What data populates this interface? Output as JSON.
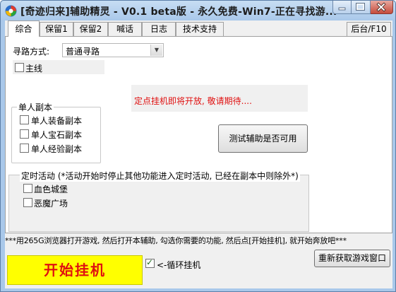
{
  "window": {
    "title": "[奇迹归来]辅助精灵 - V0.1 beta版 - 永久免费-Win7-正在寻找游..."
  },
  "tabs": [
    "综合",
    "保留1",
    "保留2",
    "喊话",
    "日志",
    "技术支持"
  ],
  "tab_right": "后台/F10",
  "path_mode": {
    "label": "寻路方式:",
    "value": "普通寻路"
  },
  "main_line": {
    "label": "主线",
    "checked": false
  },
  "notice": "定点挂机即将开放, 敬请期待....",
  "single_dungeon": {
    "title": "单人副本",
    "items": [
      {
        "label": "单人装备副本",
        "checked": false
      },
      {
        "label": "单人宝石副本",
        "checked": false
      },
      {
        "label": "单人经验副本",
        "checked": false
      }
    ]
  },
  "test_button": "测试辅助是否可用",
  "timed_events": {
    "title": "定时活动 (*活动开始时停止其他功能进入定时活动, 已经在副本中则除外*)",
    "items": [
      {
        "label": "血色城堡",
        "checked": false
      },
      {
        "label": "恶魔广场",
        "checked": false
      }
    ]
  },
  "footer_hint": "***用265G浏览器打开游戏, 然后打开本辅助, 勾选你需要的功能, 然后点[开始挂机], 就开始奔放吧***",
  "start_button": "开始挂机",
  "loop": {
    "label": "<-循环挂机",
    "checked": true
  },
  "refresh_button": "重新获取游戏窗口",
  "colors": {
    "accent_red": "#e01010",
    "start_bg": "#ffff00",
    "title_bar": "#a9c8ea"
  }
}
